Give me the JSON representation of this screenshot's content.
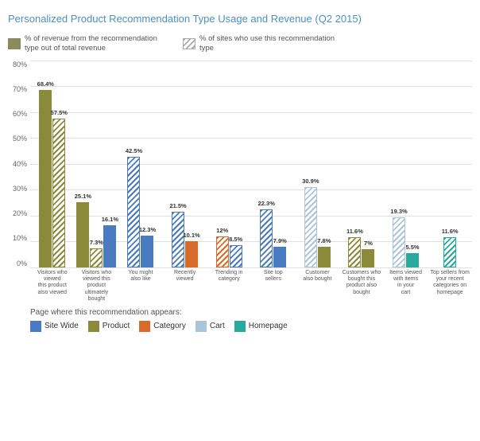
{
  "title": "Personalized Product Recommendation Type Usage and Revenue (Q2 2015)",
  "legend": {
    "solid_label": "% of revenue from the recommendation type out of total revenue",
    "hatch_label": "% of sites who use this recommendation type"
  },
  "yAxis": {
    "labels": [
      "0%",
      "10%",
      "20%",
      "30%",
      "40%",
      "50%",
      "60%",
      "70%",
      "80%"
    ]
  },
  "groups": [
    {
      "name": "Visitors who viewed this product also viewed",
      "bars": [
        {
          "value": 68.4,
          "label": "68.4%",
          "type": "solid",
          "color": "#8a8a3a"
        },
        {
          "value": 57.5,
          "label": "57.5%",
          "type": "hatch",
          "color": "#8a8a3a"
        }
      ]
    },
    {
      "name": "Visitors who viewed this product ultimately bought",
      "bars": [
        {
          "value": 25.1,
          "label": "25.1%",
          "type": "solid",
          "color": "#8a8a3a"
        },
        {
          "value": 7.3,
          "label": "7.3%",
          "type": "hatch",
          "color": "#8a8a3a"
        },
        {
          "value": 16.1,
          "label": "16.1%",
          "type": "solid",
          "color": "#4a7abf"
        }
      ]
    },
    {
      "name": "You might also like",
      "bars": [
        {
          "value": 42.5,
          "label": "42.5%",
          "type": "hatch",
          "color": "#4a7abf"
        },
        {
          "value": 12.3,
          "label": "12.3%",
          "type": "solid",
          "color": "#4a7abf"
        }
      ]
    },
    {
      "name": "Recently viewed",
      "bars": [
        {
          "value": 21.5,
          "label": "21.5%",
          "type": "hatch",
          "color": "#4a7abf"
        },
        {
          "value": 10.1,
          "label": "10.1%",
          "type": "solid",
          "color": "#d96b2a"
        }
      ]
    },
    {
      "name": "Trending in category",
      "bars": [
        {
          "value": 12.0,
          "label": "12%",
          "type": "hatch",
          "color": "#d96b2a"
        },
        {
          "value": 8.5,
          "label": "8.5%",
          "type": "hatch",
          "color": "#4a7abf"
        }
      ]
    },
    {
      "name": "Site top sellers",
      "bars": [
        {
          "value": 22.3,
          "label": "22.3%",
          "type": "hatch",
          "color": "#4a7abf"
        },
        {
          "value": 7.9,
          "label": "7.9%",
          "type": "solid",
          "color": "#4a7abf"
        }
      ]
    },
    {
      "name": "Customer also bought",
      "bars": [
        {
          "value": 30.9,
          "label": "30.9%",
          "type": "hatch",
          "color": "#aac4d8"
        },
        {
          "value": 7.8,
          "label": "7.8%",
          "type": "solid",
          "color": "#8a8a3a"
        }
      ]
    },
    {
      "name": "Customers who bought this product also bought",
      "bars": [
        {
          "value": 11.6,
          "label": "11.6%",
          "type": "hatch",
          "color": "#8a8a3a"
        },
        {
          "value": 7.0,
          "label": "7%",
          "type": "solid",
          "color": "#8a8a3a"
        }
      ]
    },
    {
      "name": "Items viewed with items in your cart",
      "bars": [
        {
          "value": 19.3,
          "label": "19.3%",
          "type": "hatch",
          "color": "#aac4d8"
        },
        {
          "value": 5.5,
          "label": "5.5%",
          "type": "solid",
          "color": "#29a89e"
        }
      ]
    },
    {
      "name": "Top sellers from your recent categories on homepage",
      "bars": [
        {
          "value": 11.6,
          "label": "11.6%",
          "type": "hatch",
          "color": "#29a89e"
        }
      ]
    }
  ],
  "xLabels": [
    [
      "Visitors who viewed",
      "this product",
      "also viewed"
    ],
    [
      "Visitors who viewed this",
      "product ultimately",
      "bought"
    ],
    [
      "You might",
      "also like"
    ],
    [
      "Recently",
      "viewed"
    ],
    [
      "Trending in",
      "category"
    ],
    [
      "Site top",
      "sellers"
    ],
    [
      "Customer",
      "also bought"
    ],
    [
      "Customers who bought this",
      "product also",
      "bought"
    ],
    [
      "Items viewed with items",
      "in your",
      "cart"
    ],
    [
      "Top sellers from your recent",
      "categories on",
      "homepage"
    ]
  ],
  "pageLabel": "Page where this recommendation appears:",
  "bottomLegend": [
    {
      "color": "#4a7abf",
      "label": "Site Wide"
    },
    {
      "color": "#8a8a3a",
      "label": "Product"
    },
    {
      "color": "#d96b2a",
      "label": "Category"
    },
    {
      "color": "#aac4d8",
      "label": "Cart"
    },
    {
      "color": "#29a89e",
      "label": "Homepage"
    }
  ]
}
